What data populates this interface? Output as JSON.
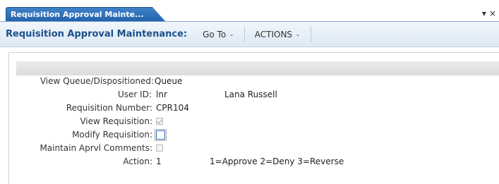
{
  "tab": {
    "label": "Requisition Approval Mainte...",
    "dropdown_glyph": "▾",
    "close_glyph": "×"
  },
  "titlebar": {
    "title": "Requisition Approval Maintenance:",
    "menus": [
      {
        "label": "Go To",
        "caret": "⌄"
      },
      {
        "label": "ACTIONS",
        "caret": "⌄"
      }
    ]
  },
  "form": {
    "view_queue": {
      "label": "View Queue/Dispositioned:",
      "value": "Queue"
    },
    "user_id": {
      "label": "User ID:",
      "value": "lnr",
      "name": "Lana Russell"
    },
    "requisition_number": {
      "label": "Requisition Number:",
      "value": "CPR104"
    },
    "view_requisition": {
      "label": "View Requisition:",
      "checked": true,
      "enabled": false
    },
    "modify_requisition": {
      "label": "Modify Requisition:",
      "checked": false,
      "enabled": true
    },
    "maintain_comments": {
      "label": "Maintain Aprvl Comments:",
      "checked": false,
      "enabled": false
    },
    "action": {
      "label": "Action:",
      "value": "1",
      "hint": "1=Approve 2=Deny 3=Reverse"
    }
  }
}
